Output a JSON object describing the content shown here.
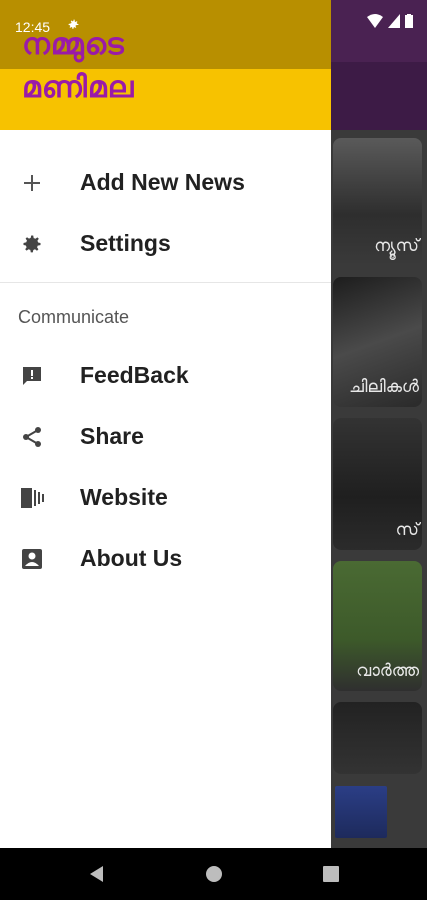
{
  "status_bar": {
    "time": "12:45"
  },
  "header": {
    "title_line1": "നമ്മുടെ",
    "title_line2": "മണിമല"
  },
  "menu": {
    "primary": [
      {
        "label": "Add New News",
        "icon": "plus-icon"
      },
      {
        "label": "Settings",
        "icon": "gear-icon"
      }
    ],
    "section_title": "Communicate",
    "communicate": [
      {
        "label": "FeedBack",
        "icon": "feedback-icon"
      },
      {
        "label": "Share",
        "icon": "share-icon"
      },
      {
        "label": "Website",
        "icon": "website-icon"
      },
      {
        "label": "About Us",
        "icon": "about-icon"
      }
    ]
  },
  "background_cards": [
    "ന്യൂസ്",
    "ചിലികൾ",
    "സ്",
    "വാർത്ത"
  ],
  "colors": {
    "header_yellow": "#f7c200",
    "header_dark_yellow": "#b88f00",
    "brand_purple": "#9a1aa8",
    "toolbar_purple": "#4a2252"
  }
}
